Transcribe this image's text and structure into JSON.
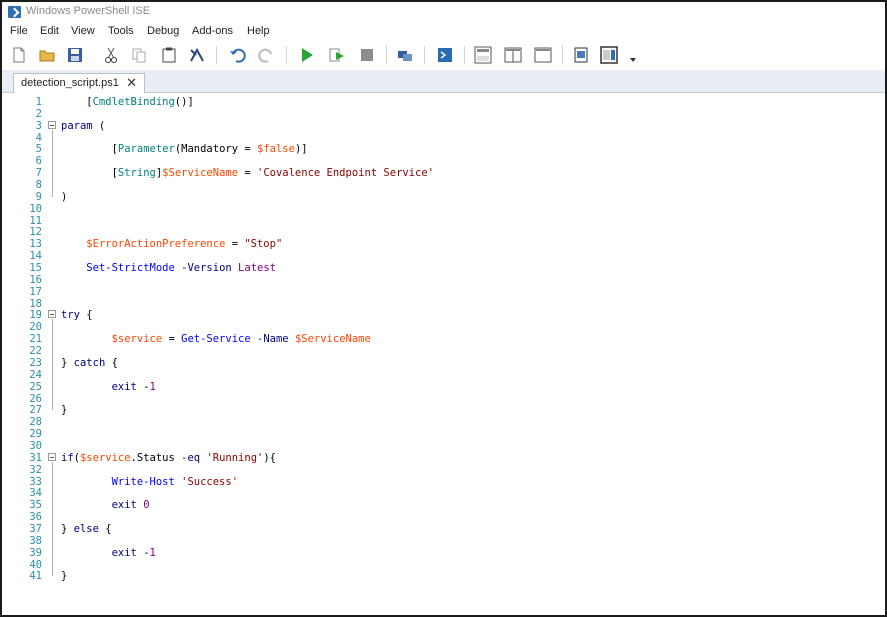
{
  "window": {
    "title": "Windows PowerShell ISE"
  },
  "menu": [
    "File",
    "Edit",
    "View",
    "Tools",
    "Debug",
    "Add-ons",
    "Help"
  ],
  "toolbar": {
    "buttons": [
      "new-script",
      "open-script",
      "save-script",
      "cut",
      "copy",
      "paste",
      "clear-console",
      "undo",
      "redo",
      "run-script",
      "run-selection",
      "stop-operation",
      "new-remote-tab",
      "start-powershell-exe",
      "show-script-top",
      "show-script-right",
      "show-script-maximized",
      "show-command-window",
      "show-command-addon"
    ]
  },
  "tab": {
    "name": "detection_script.ps1",
    "close": "✕"
  },
  "colors": {
    "type": "#008080",
    "keyword": "#00008b",
    "variable": "#ff4500",
    "string": "#8b0000",
    "command": "#0000ff",
    "parameter": "#000080",
    "number": "#800080"
  },
  "editor": {
    "lines": [
      {
        "n": "1",
        "t": "    [CmdletBinding()]"
      },
      {
        "n": "2",
        "t": ""
      },
      {
        "n": "3",
        "t": "param ("
      },
      {
        "n": "4",
        "t": ""
      },
      {
        "n": "5",
        "t": "        [Parameter(Mandatory = $false)]"
      },
      {
        "n": "6",
        "t": ""
      },
      {
        "n": "7",
        "t": "        [String]$ServiceName = 'Covalence Endpoint Service'"
      },
      {
        "n": "8",
        "t": ""
      },
      {
        "n": "9",
        "t": ")"
      },
      {
        "n": "10",
        "t": ""
      },
      {
        "n": "11",
        "t": ""
      },
      {
        "n": "12",
        "t": ""
      },
      {
        "n": "13",
        "t": "    $ErrorActionPreference = \"Stop\""
      },
      {
        "n": "14",
        "t": ""
      },
      {
        "n": "15",
        "t": "    Set-StrictMode -Version Latest"
      },
      {
        "n": "16",
        "t": ""
      },
      {
        "n": "17",
        "t": ""
      },
      {
        "n": "18",
        "t": ""
      },
      {
        "n": "19",
        "t": "try {"
      },
      {
        "n": "20",
        "t": ""
      },
      {
        "n": "21",
        "t": "        $service = Get-Service -Name $ServiceName"
      },
      {
        "n": "22",
        "t": ""
      },
      {
        "n": "23",
        "t": "} catch {"
      },
      {
        "n": "24",
        "t": ""
      },
      {
        "n": "25",
        "t": "        exit -1"
      },
      {
        "n": "26",
        "t": ""
      },
      {
        "n": "27",
        "t": "}"
      },
      {
        "n": "28",
        "t": ""
      },
      {
        "n": "29",
        "t": ""
      },
      {
        "n": "30",
        "t": ""
      },
      {
        "n": "31",
        "t": "if($service.Status -eq 'Running'){"
      },
      {
        "n": "32",
        "t": ""
      },
      {
        "n": "33",
        "t": "        Write-Host 'Success'"
      },
      {
        "n": "34",
        "t": ""
      },
      {
        "n": "35",
        "t": "        exit 0"
      },
      {
        "n": "36",
        "t": ""
      },
      {
        "n": "37",
        "t": "} else {"
      },
      {
        "n": "38",
        "t": ""
      },
      {
        "n": "39",
        "t": "        exit -1"
      },
      {
        "n": "40",
        "t": ""
      },
      {
        "n": "41",
        "t": "}"
      }
    ]
  }
}
